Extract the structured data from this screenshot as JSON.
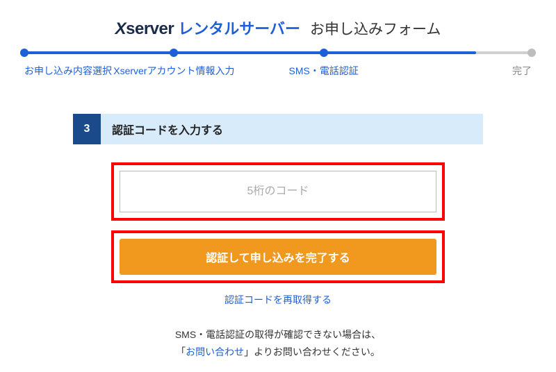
{
  "header": {
    "brand": "Xserver",
    "rental": "レンタルサーバー",
    "form_label": "お申し込みフォーム"
  },
  "progress": {
    "steps": [
      {
        "label": "お申し込み内容選択",
        "pos": 0,
        "active": true
      },
      {
        "label": "Xserverアカウント情報入力",
        "pos": 29.5,
        "active": true
      },
      {
        "label": "SMS・電話認証",
        "pos": 59,
        "active": true
      },
      {
        "label": "完了",
        "pos": 100,
        "active": false
      }
    ],
    "fill_width": "89%"
  },
  "section": {
    "number": "3",
    "title": "認証コードを入力する"
  },
  "form": {
    "code_placeholder": "5桁のコード",
    "submit_label": "認証して申し込みを完了する",
    "retry_label": "認証コードを再取得する"
  },
  "note": {
    "line1": "SMS・電話認証の取得が確認できない場合は、",
    "line2_prefix": "「",
    "line2_link": "お問い合わせ",
    "line2_suffix": "」よりお問い合わせください。"
  }
}
